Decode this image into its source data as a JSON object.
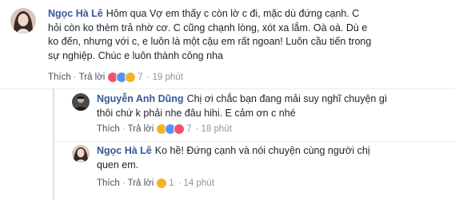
{
  "comments": [
    {
      "author": "Ngọc Hà Lê",
      "lines": [
        "Hôm qua Vợ em thấy c còn lờ c đi, mặc dù đứng cạnh. C",
        "hỏi còn ko thèm trả nhờ cơ. C cũng chạnh lòng, xót xa lắm. Oà oà. Dù e",
        "ko đến, nhưng với c, e luôn là một cậu em rất ngoan! Luôn cầu tiến trong",
        "sự nghiệp. Chúc e luôn thành công nha"
      ],
      "like_label": "Thích",
      "reply_label": "Trả lời",
      "reaction_count": "7",
      "time": "19 phút",
      "reactions": [
        "love",
        "like",
        "wow"
      ]
    },
    {
      "author": "Nguyễn Anh Dũng",
      "lines": [
        "Chị ơi chắc bạn đang mải suy nghĩ chuyện gì",
        "thôi chứ k phải nhe đâu hihi. E cảm ơn c nhé"
      ],
      "like_label": "Thích",
      "reply_label": "Trả lời",
      "reaction_count": "7",
      "time": "18 phút",
      "reactions": [
        "wow",
        "like",
        "love"
      ]
    },
    {
      "author": "Ngọc Hà Lê",
      "lines": [
        "Ko hề! Đứng cạnh và nói chuyện cùng người chị",
        "quen em."
      ],
      "like_label": "Thích",
      "reply_label": "Trả lời",
      "reaction_count": "1",
      "time": "14 phút",
      "reactions": [
        "sad"
      ]
    }
  ],
  "colors": {
    "author": "#365899",
    "text": "#1d2129",
    "meta": "#90949c",
    "like": "#5890ff",
    "love": "#f25268",
    "wow": "#f7b125"
  }
}
